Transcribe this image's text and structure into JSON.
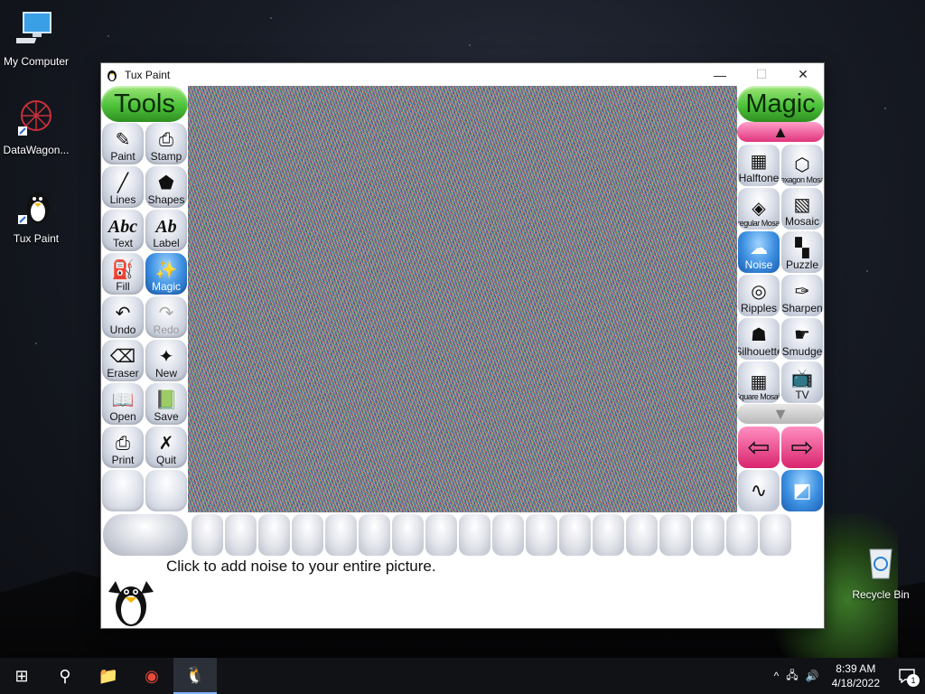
{
  "desktop": {
    "icons": [
      {
        "label": "My Computer"
      },
      {
        "label": "DataWagon..."
      },
      {
        "label": "Tux Paint"
      },
      {
        "label": "Recycle Bin"
      }
    ]
  },
  "window": {
    "title": "Tux Paint",
    "minimize": "—",
    "maximize": "☐",
    "close": "✕"
  },
  "tools": {
    "header": "Tools",
    "items": [
      {
        "label": "Paint",
        "glyph": "✎"
      },
      {
        "label": "Stamp",
        "glyph": "⎙"
      },
      {
        "label": "Lines",
        "glyph": "╱"
      },
      {
        "label": "Shapes",
        "glyph": "⬟"
      },
      {
        "label": "Text",
        "glyph": "Abc"
      },
      {
        "label": "Label",
        "glyph": "Ab"
      },
      {
        "label": "Fill",
        "glyph": "⛽"
      },
      {
        "label": "Magic",
        "glyph": "✨"
      },
      {
        "label": "Undo",
        "glyph": "↶"
      },
      {
        "label": "Redo",
        "glyph": "↷"
      },
      {
        "label": "Eraser",
        "glyph": "⌫"
      },
      {
        "label": "New",
        "glyph": "✦"
      },
      {
        "label": "Open",
        "glyph": "📖"
      },
      {
        "label": "Save",
        "glyph": "📗"
      },
      {
        "label": "Print",
        "glyph": "⎙"
      },
      {
        "label": "Quit",
        "glyph": "✗"
      }
    ]
  },
  "magic": {
    "header": "Magic",
    "scroll_up": "▲",
    "scroll_down": "▼",
    "items": [
      {
        "label": "Halftone",
        "glyph": "▦"
      },
      {
        "label": "Hexagon Mosaic",
        "glyph": "⬡"
      },
      {
        "label": "Irregular Mosaic",
        "glyph": "◈"
      },
      {
        "label": "Mosaic",
        "glyph": "▧"
      },
      {
        "label": "Noise",
        "glyph": "☁"
      },
      {
        "label": "Puzzle",
        "glyph": "▚"
      },
      {
        "label": "Ripples",
        "glyph": "◎"
      },
      {
        "label": "Sharpen",
        "glyph": "✑"
      },
      {
        "label": "Silhouette",
        "glyph": "☗"
      },
      {
        "label": "Smudge",
        "glyph": "☛"
      },
      {
        "label": "Square Mosaic",
        "glyph": "▦"
      },
      {
        "label": "TV",
        "glyph": "📺"
      }
    ],
    "prev_arrow": "⇦",
    "next_arrow": "⇨",
    "mode_paint": "∿",
    "mode_fullscreen": "◩"
  },
  "status": {
    "message": "Click to add noise to your entire picture."
  },
  "taskbar": {
    "start_glyph": "⊞",
    "search_glyph": "⚲",
    "explorer_glyph": "📁",
    "chrome_glyph": "◉",
    "tuxpaint_glyph": "🐧",
    "chevron": "^",
    "network_glyph": "🖧",
    "volume_glyph": "🔊",
    "time": "8:39 AM",
    "date": "4/18/2022",
    "notification_count": "1"
  }
}
